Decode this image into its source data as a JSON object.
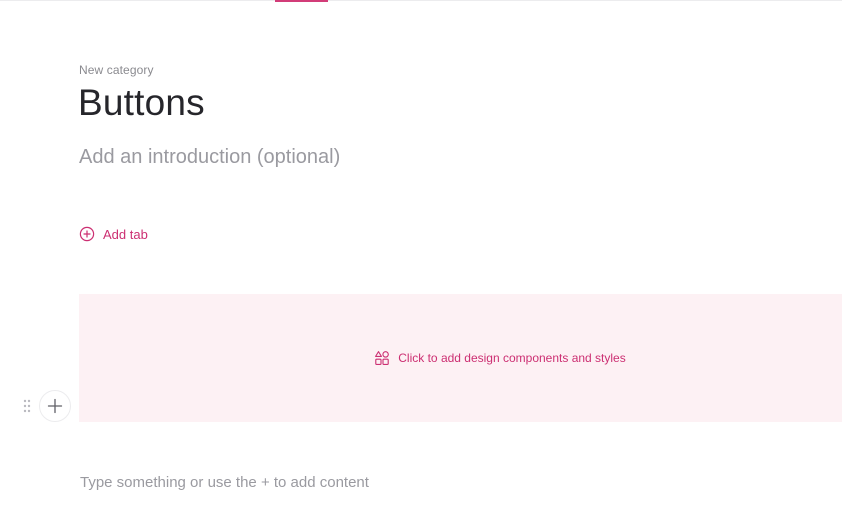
{
  "category": {
    "label": "New category"
  },
  "page": {
    "title": "Buttons",
    "intro_placeholder": "Add an introduction (optional)"
  },
  "tabs": {
    "add_label": "Add tab",
    "add_icon": "plus-circle-icon"
  },
  "components_block": {
    "cta_label": "Click to add design components and styles",
    "cta_icon": "components-icon"
  },
  "editor": {
    "add_block_icon": "plus-icon",
    "drag_icon": "drag-handle-icon",
    "content_placeholder": "Type something or use the + to add content"
  },
  "colors": {
    "accent": "#cc2f72",
    "block_background": "#fdf1f4",
    "title_text": "#26262b",
    "muted_text": "#9a9aa0"
  }
}
